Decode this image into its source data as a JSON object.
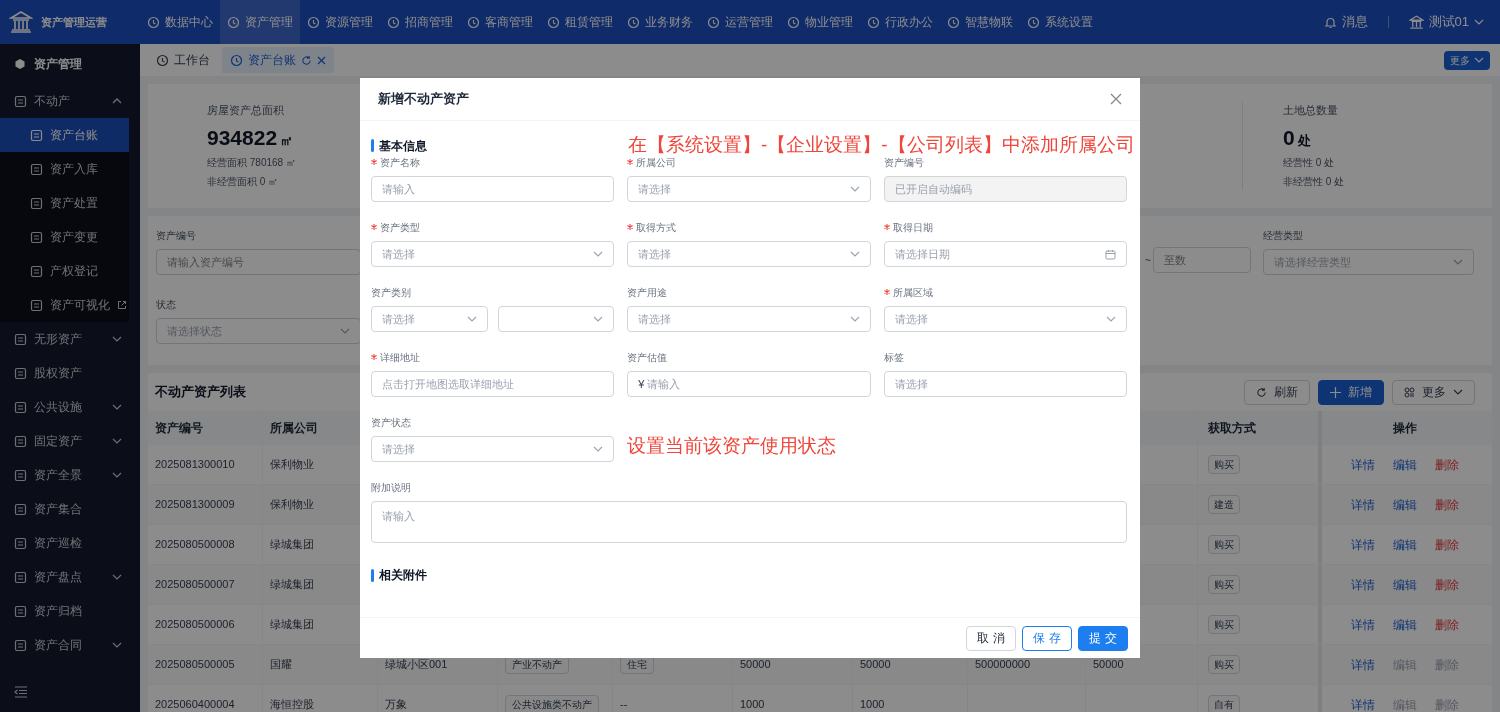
{
  "app": {
    "title": "资产管理运营"
  },
  "nav": [
    {
      "label": "数据中心",
      "selected": false
    },
    {
      "label": "资产管理",
      "selected": true
    },
    {
      "label": "资源管理",
      "selected": false
    },
    {
      "label": "招商管理",
      "selected": false
    },
    {
      "label": "客商管理",
      "selected": false
    },
    {
      "label": "租赁管理",
      "selected": false
    },
    {
      "label": "业务财务",
      "selected": false
    },
    {
      "label": "运营管理",
      "selected": false
    },
    {
      "label": "物业管理",
      "selected": false
    },
    {
      "label": "行政办公",
      "selected": false
    },
    {
      "label": "智慧物联",
      "selected": false
    },
    {
      "label": "系统设置",
      "selected": false
    }
  ],
  "user_menu": {
    "messages": "消息",
    "user": "测试01"
  },
  "sidebar": {
    "title": "资产管理",
    "items": [
      {
        "label": "不动产",
        "expanded": true,
        "children": [
          {
            "label": "资产台账",
            "selected": true,
            "external": false
          },
          {
            "label": "资产入库",
            "selected": false,
            "external": false
          },
          {
            "label": "资产处置",
            "selected": false,
            "external": false
          },
          {
            "label": "资产变更",
            "selected": false,
            "external": false
          },
          {
            "label": "产权登记",
            "selected": false,
            "external": false
          },
          {
            "label": "资产可视化",
            "selected": false,
            "external": true
          }
        ]
      },
      {
        "label": "无形资产",
        "expanded": false
      },
      {
        "label": "股权资产"
      },
      {
        "label": "公共设施",
        "expanded": false
      },
      {
        "label": "固定资产",
        "expanded": false
      },
      {
        "label": "资产全景",
        "expanded": false
      },
      {
        "label": "资产集合"
      },
      {
        "label": "资产巡检"
      },
      {
        "label": "资产盘点",
        "expanded": false
      },
      {
        "label": "资产归档"
      },
      {
        "label": "资产合同",
        "expanded": false
      }
    ]
  },
  "tabs": [
    {
      "label": "工作台",
      "selected": false
    },
    {
      "label": "资产台账",
      "selected": true
    }
  ],
  "tabs_more": "更多",
  "stats": [
    {
      "title": "房屋资产总面积",
      "value": "934822",
      "unit": "㎡",
      "lines": [
        "经营面积 780168 ㎡",
        "非经营面积 0 ㎡"
      ]
    },
    {
      "title": "土地总数量",
      "value": "0",
      "unit": "处",
      "lines": [
        "经营性 0 处",
        "非经营性 0 处"
      ]
    }
  ],
  "filters": {
    "asset_no": {
      "label": "资产编号",
      "placeholder": "请输入资产编号"
    },
    "status": {
      "label": "状态",
      "placeholder": "请选择状态"
    },
    "range_sep": "~",
    "range_to": {
      "placeholder": "至数"
    },
    "biz_type": {
      "label": "经营类型",
      "placeholder": "请选择经营类型"
    }
  },
  "table": {
    "title": "不动产资产列表",
    "buttons": [
      {
        "label": "刷新",
        "kind": "refresh"
      },
      {
        "label": "新增",
        "kind": "add"
      },
      {
        "label": "更多",
        "kind": "more"
      }
    ],
    "columns": [
      "资产编号",
      "所属公司"
    ],
    "acq_column": "获取方式",
    "actions_column": "操作",
    "rows": [
      {
        "cells": [
          {
            "text": "2025081300010",
            "kind": "text"
          },
          {
            "text": "保利物业",
            "kind": "text"
          }
        ],
        "acquisition": "购买",
        "actions": [
          {
            "label": "详情",
            "kind": "view",
            "disabled": false
          },
          {
            "label": "编辑",
            "kind": "edit",
            "disabled": false
          },
          {
            "label": "删除",
            "kind": "delete",
            "disabled": false
          }
        ]
      },
      {
        "cells": [
          {
            "text": "2025081300009",
            "kind": "text"
          },
          {
            "text": "保利物业",
            "kind": "text"
          }
        ],
        "acquisition": "建造",
        "actions": [
          {
            "label": "详情",
            "kind": "view",
            "disabled": false
          },
          {
            "label": "编辑",
            "kind": "edit",
            "disabled": false
          },
          {
            "label": "删除",
            "kind": "delete",
            "disabled": false
          }
        ]
      },
      {
        "cells": [
          {
            "text": "2025080500008",
            "kind": "text"
          },
          {
            "text": "绿城集团",
            "kind": "text"
          }
        ],
        "acquisition": "购买",
        "actions": [
          {
            "label": "详情",
            "kind": "view",
            "disabled": false
          },
          {
            "label": "编辑",
            "kind": "edit",
            "disabled": false
          },
          {
            "label": "删除",
            "kind": "delete",
            "disabled": false
          }
        ]
      },
      {
        "cells": [
          {
            "text": "2025080500007",
            "kind": "text"
          },
          {
            "text": "绿城集团",
            "kind": "text"
          }
        ],
        "acquisition": "购买",
        "actions": [
          {
            "label": "详情",
            "kind": "view",
            "disabled": false
          },
          {
            "label": "编辑",
            "kind": "edit",
            "disabled": false
          },
          {
            "label": "删除",
            "kind": "delete",
            "disabled": false
          }
        ]
      },
      {
        "cells": [
          {
            "text": "2025080500006",
            "kind": "text"
          },
          {
            "text": "绿城集团",
            "kind": "text"
          }
        ],
        "acquisition": "购买",
        "actions": [
          {
            "label": "详情",
            "kind": "view",
            "disabled": false
          },
          {
            "label": "编辑",
            "kind": "edit",
            "disabled": false
          },
          {
            "label": "删除",
            "kind": "delete",
            "disabled": false
          }
        ]
      },
      {
        "cells": [
          {
            "text": "2025080500005",
            "kind": "text"
          },
          {
            "text": "国耀",
            "kind": "text"
          },
          {
            "text": "绿城小区001",
            "kind": "text"
          },
          {
            "text": "产业不动产",
            "kind": "tag"
          },
          {
            "text": "住宅",
            "kind": "tag"
          },
          {
            "text": "50000",
            "kind": "text"
          },
          {
            "text": "50000",
            "kind": "text"
          },
          {
            "text": "500000000",
            "kind": "text"
          },
          {
            "text": "50000",
            "kind": "text"
          }
        ],
        "acquisition": "购买",
        "actions": [
          {
            "label": "详情",
            "kind": "view",
            "disabled": false
          },
          {
            "label": "编辑",
            "kind": "edit",
            "disabled": true
          },
          {
            "label": "删除",
            "kind": "delete",
            "disabled": true
          }
        ]
      },
      {
        "cells": [
          {
            "text": "2025060400004",
            "kind": "text"
          },
          {
            "text": "海恒控股",
            "kind": "text"
          },
          {
            "text": "万象",
            "kind": "text"
          },
          {
            "text": "公共设施类不动产",
            "kind": "tag"
          },
          {
            "text": "--",
            "kind": "text"
          },
          {
            "text": "1000",
            "kind": "text"
          },
          {
            "text": "1000",
            "kind": "text"
          }
        ],
        "acquisition": "自有",
        "actions": [
          {
            "label": "详情",
            "kind": "view",
            "disabled": false
          },
          {
            "label": "编辑",
            "kind": "edit",
            "disabled": true
          },
          {
            "label": "删除",
            "kind": "delete",
            "disabled": true
          }
        ]
      }
    ]
  },
  "modal": {
    "title": "新增不动产资产",
    "section_title": "基本信息",
    "section_note": "在【系统设置】-【企业设置】-【公司列表】中添加所属公司",
    "fields": [
      {
        "label": "资产名称",
        "required": true,
        "kind": "text",
        "placeholder": "请输入",
        "disabled": false
      },
      {
        "label": "所属公司",
        "required": true,
        "kind": "select",
        "placeholder": "请选择",
        "disabled": false
      },
      {
        "label": "资产编号",
        "required": false,
        "kind": "text",
        "placeholder": "已开启自动编码",
        "disabled": true
      },
      {
        "label": "资产类型",
        "required": true,
        "kind": "select",
        "placeholder": "请选择",
        "disabled": false
      },
      {
        "label": "取得方式",
        "required": true,
        "kind": "select",
        "placeholder": "请选择",
        "disabled": false
      },
      {
        "label": "取得日期",
        "required": true,
        "kind": "date",
        "placeholder": "请选择日期",
        "disabled": false
      },
      {
        "label": "资产类别",
        "required": false,
        "kind": "cascader",
        "placeholder": "请选择",
        "disabled": false
      },
      {
        "label": "资产用途",
        "required": false,
        "kind": "select",
        "placeholder": "请选择",
        "disabled": false
      },
      {
        "label": "所属区域",
        "required": true,
        "kind": "select",
        "placeholder": "请选择",
        "disabled": false
      },
      {
        "label": "详细地址",
        "required": true,
        "kind": "text",
        "placeholder": "点击打开地图选取详细地址",
        "disabled": false
      },
      {
        "label": "资产估值",
        "required": false,
        "kind": "money",
        "prefix": "¥",
        "placeholder": "请输入",
        "disabled": false
      },
      {
        "label": "标签",
        "required": false,
        "kind": "select_plain",
        "placeholder": "请选择",
        "disabled": false
      },
      {
        "label": "资产状态",
        "required": false,
        "kind": "select",
        "placeholder": "请选择",
        "disabled": false,
        "note": "设置当前该资产使用状态"
      },
      {
        "label": "附加说明",
        "required": false,
        "kind": "textarea",
        "placeholder": "请输入",
        "disabled": false
      }
    ],
    "attachments_title": "相关附件",
    "buttons": [
      {
        "label": "取 消",
        "kind": "default"
      },
      {
        "label": "保 存",
        "kind": "outline"
      },
      {
        "label": "提 交",
        "kind": "primary"
      }
    ]
  }
}
